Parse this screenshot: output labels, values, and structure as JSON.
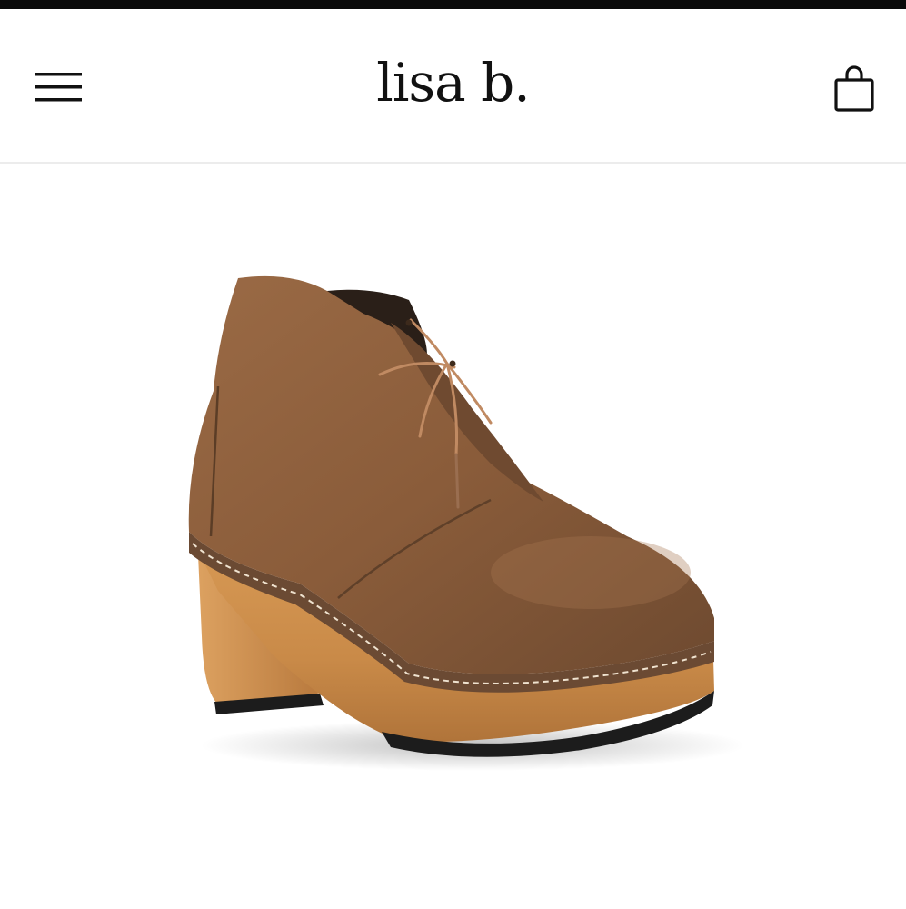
{
  "header": {
    "brand": "lisa b.",
    "menu_icon": "hamburger-menu-icon",
    "cart_icon": "shopping-bag-icon"
  },
  "product": {
    "image_subject": "brown-suede-lace-up-clog-bootie",
    "colors": {
      "suede": "#8a5d3b",
      "wood_heel": "#c98a4a",
      "sole": "#1c1c1c",
      "lace": "#c08a62"
    }
  },
  "colors": {
    "header_bg": "#ffffff",
    "header_border": "#ececec",
    "brand_text": "#111111",
    "status_strip": "#0a0a0a"
  }
}
